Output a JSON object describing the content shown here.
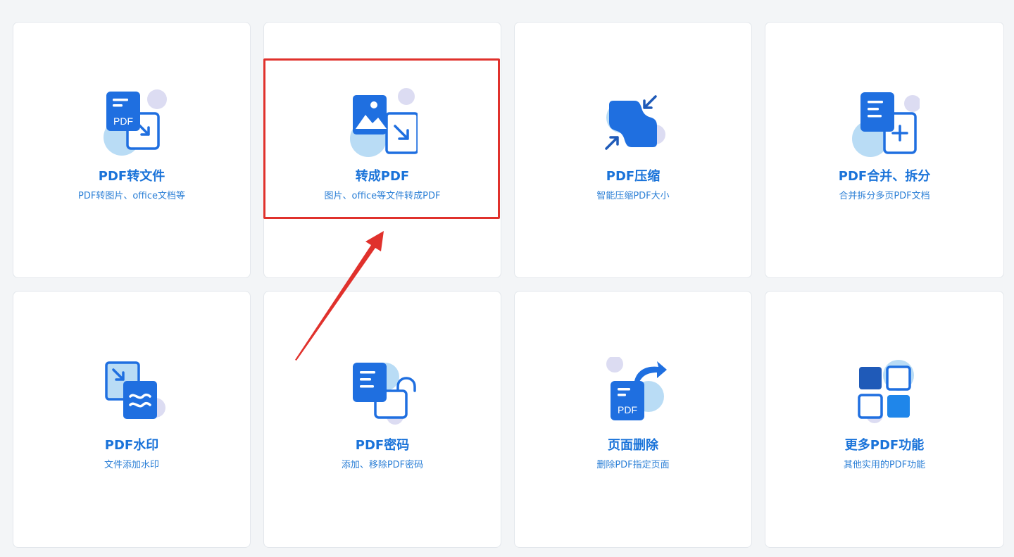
{
  "cards": [
    {
      "title": "PDF转文件",
      "subtitle": "PDF转图片、office文档等",
      "icon": "pdf-to-file-icon",
      "badge": "PDF"
    },
    {
      "title": "转成PDF",
      "subtitle": "图片、office等文件转成PDF",
      "icon": "to-pdf-icon"
    },
    {
      "title": "PDF压缩",
      "subtitle": "智能压缩PDF大小",
      "icon": "compress-icon"
    },
    {
      "title": "PDF合并、拆分",
      "subtitle": "合并拆分多页PDF文档",
      "icon": "merge-split-icon"
    },
    {
      "title": "PDF水印",
      "subtitle": "文件添加水印",
      "icon": "watermark-icon"
    },
    {
      "title": "PDF密码",
      "subtitle": "添加、移除PDF密码",
      "icon": "password-icon"
    },
    {
      "title": "页面删除",
      "subtitle": "删除PDF指定页面",
      "icon": "delete-page-icon",
      "badge": "PDF"
    },
    {
      "title": "更多PDF功能",
      "subtitle": "其他实用的PDF功能",
      "icon": "more-functions-icon"
    }
  ],
  "colors": {
    "primary": "#1a73d9",
    "icon_blue": "#1f6fe0",
    "icon_light": "#b9dcf5",
    "icon_lavender": "#dcdcf2",
    "highlight": "#e0312c"
  }
}
